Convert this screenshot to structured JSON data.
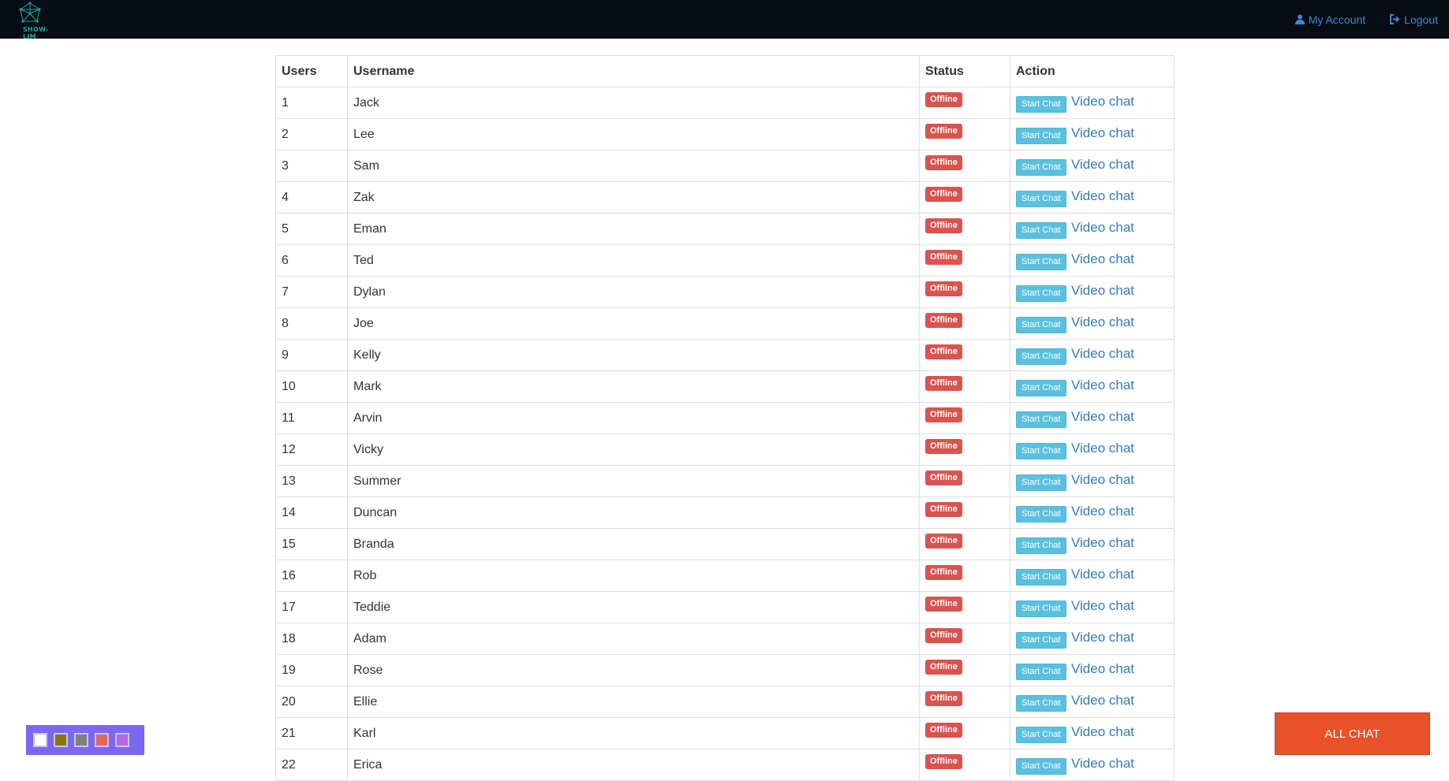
{
  "nav": {
    "logo_text": "SHOW-LIM",
    "my_account_label": "My Account",
    "logout_label": "Logout"
  },
  "table": {
    "headers": [
      "Users",
      "Username",
      "Status",
      "Action"
    ],
    "rows": [
      {
        "num": "1",
        "name": "Jack",
        "status": "Offline"
      },
      {
        "num": "2",
        "name": "Lee",
        "status": "Offline"
      },
      {
        "num": "3",
        "name": "Sam",
        "status": "Offline"
      },
      {
        "num": "4",
        "name": "Zak",
        "status": "Offline"
      },
      {
        "num": "5",
        "name": "Eman",
        "status": "Offline"
      },
      {
        "num": "6",
        "name": "Ted",
        "status": "Offline"
      },
      {
        "num": "7",
        "name": "Dylan",
        "status": "Offline"
      },
      {
        "num": "8",
        "name": "Joe",
        "status": "Offline"
      },
      {
        "num": "9",
        "name": "Kelly",
        "status": "Offline"
      },
      {
        "num": "10",
        "name": "Mark",
        "status": "Offline"
      },
      {
        "num": "11",
        "name": "Arvin",
        "status": "Offline"
      },
      {
        "num": "12",
        "name": "Vicky",
        "status": "Offline"
      },
      {
        "num": "13",
        "name": "Summer",
        "status": "Offline"
      },
      {
        "num": "14",
        "name": "Duncan",
        "status": "Offline"
      },
      {
        "num": "15",
        "name": "Branda",
        "status": "Offline"
      },
      {
        "num": "16",
        "name": "Rob",
        "status": "Offline"
      },
      {
        "num": "17",
        "name": "Teddie",
        "status": "Offline"
      },
      {
        "num": "18",
        "name": "Adam",
        "status": "Offline"
      },
      {
        "num": "19",
        "name": "Rose",
        "status": "Offline"
      },
      {
        "num": "20",
        "name": "Ellie",
        "status": "Offline"
      },
      {
        "num": "21",
        "name": "Karl",
        "status": "Offline"
      },
      {
        "num": "22",
        "name": "Erica",
        "status": "Offline"
      }
    ],
    "start_chat_label": "Start Chat",
    "video_chat_label": "Video chat"
  },
  "color_picker": {
    "swatches": [
      "#ffffff",
      "#8b7500",
      "#808080",
      "#e06666",
      "#b566e0"
    ]
  },
  "all_chat_label": "ALL CHAT",
  "colors": {
    "navbar": "#080c13",
    "offline_badge": "#d9534f",
    "start_chat_button": "#5bc0de",
    "link": "#337ab7",
    "all_chat": "#e8512a",
    "picker_bg": "#7b68ee"
  }
}
